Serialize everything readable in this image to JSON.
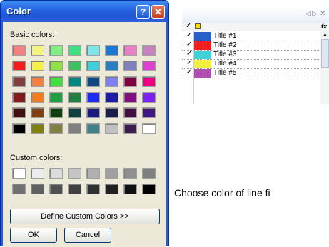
{
  "dialog": {
    "title": "Color",
    "help_button": "?",
    "close_button": "✕",
    "basic_label": "Basic colors:",
    "custom_label": "Custom colors:",
    "define_button": "Define Custom Colors >>",
    "ok_button": "OK",
    "cancel_button": "Cancel",
    "basic_colors": [
      "#f48080",
      "#f4f480",
      "#80f080",
      "#40e080",
      "#80e4ec",
      "#1c78d8",
      "#e880c8",
      "#c880c0",
      "#f41c1c",
      "#f4f048",
      "#90e048",
      "#40c060",
      "#40d0d8",
      "#2880c0",
      "#8080c0",
      "#e040d0",
      "#804040",
      "#f48040",
      "#40e040",
      "#008880",
      "#104880",
      "#8080f0",
      "#800040",
      "#f00080",
      "#801c1c",
      "#f47c20",
      "#20a040",
      "#208040",
      "#1c2cf0",
      "#1c1ca8",
      "#80107c",
      "#8020f0",
      "#401010",
      "#804010",
      "#104010",
      "#104040",
      "#1c1c80",
      "#1c1c4c",
      "#401040",
      "#401880",
      "#000000",
      "#808010",
      "#808040",
      "#808080",
      "#408088",
      "#c0c0c0",
      "#3c1c4c",
      "#ffffff"
    ],
    "custom_colors": [
      "#ffffff",
      "#ececec",
      "#dcdcdc",
      "#c4c4c4",
      "#b0b0b0",
      "#a0a0a0",
      "#909090",
      "#808080",
      "#707070",
      "#606060",
      "#505050",
      "#404040",
      "#303030",
      "#202020",
      "#101010",
      "#000000"
    ]
  },
  "panel": {
    "nav_left": "◁",
    "nav_right": "▷",
    "close": "✕",
    "fx": "fx",
    "check": "✓",
    "scroll_up": "▲",
    "items": [
      {
        "name": "Title #1",
        "color": "#2860c8"
      },
      {
        "name": "Title #2",
        "color": "#f02020"
      },
      {
        "name": "Title #3",
        "color": "#40d0d8"
      },
      {
        "name": "Title #4",
        "color": "#f0f040"
      },
      {
        "name": "Title #5",
        "color": "#b050b0"
      }
    ]
  },
  "caption": "Choose color of line fi"
}
